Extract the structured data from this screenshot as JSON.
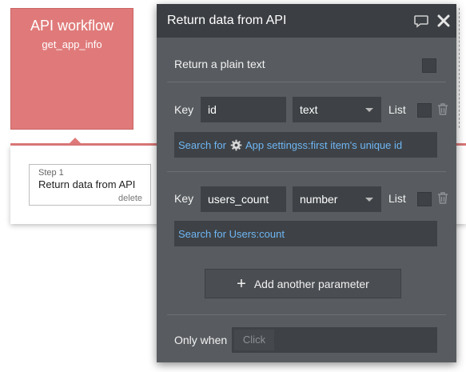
{
  "workflow": {
    "title": "API workflow",
    "subtitle": "get_app_info",
    "step_label": "Step 1",
    "step_title": "Return data from API",
    "step_delete": "delete"
  },
  "editor": {
    "title": "Return data from API",
    "plain_text_label": "Return a plain text",
    "params": [
      {
        "key_label": "Key",
        "key_value": "id",
        "type": "text",
        "list_label": "List",
        "expression_prefix": "Search for",
        "expression_rest": "App settingss:first item's unique id",
        "expression_icon": "gear-icon"
      },
      {
        "key_label": "Key",
        "key_value": "users_count",
        "type": "number",
        "list_label": "List",
        "expression": "Search for Users:count"
      }
    ],
    "add_param_label": "Add another parameter",
    "only_when_label": "Only when",
    "only_when_placeholder": "Click"
  },
  "colors": {
    "workflow_card": "#e07a7a",
    "editor_bg": "#585c60",
    "editor_header": "#3b3f43",
    "input_bg": "#3e4246",
    "expression_text": "#6fb6f4"
  }
}
